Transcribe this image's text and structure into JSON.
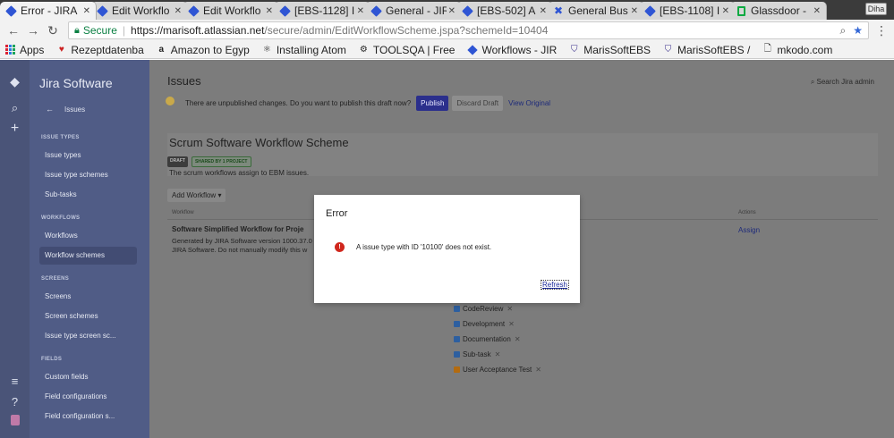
{
  "browser": {
    "tabs": [
      {
        "title": "Error - JIRA",
        "active": true
      },
      {
        "title": "Edit Workflo",
        "active": false
      },
      {
        "title": "Edit Workflo",
        "active": false
      },
      {
        "title": "[EBS-1128] I",
        "active": false
      },
      {
        "title": "General - JIR",
        "active": false
      },
      {
        "title": "[EBS-502] A",
        "active": false
      },
      {
        "title": "General Bus",
        "active": false
      },
      {
        "title": "[EBS-1108] I",
        "active": false
      },
      {
        "title": "Glassdoor - ",
        "active": false
      }
    ],
    "profile_label": "Diha",
    "address": {
      "secure_label": "Secure",
      "host": "https://marisoft.atlassian.net",
      "path": "/secure/admin/EditWorkflowScheme.jspa?schemeId=10404"
    },
    "bookmarks": [
      "Apps",
      "Rezeptdatenba",
      "Amazon to Egyp",
      "Installing Atom",
      "TOOLSQA | Free",
      "Workflows - JIR",
      "MarisSoftEBS",
      "MarisSoftEBS /",
      "mkodo.com"
    ]
  },
  "sidebar": {
    "product": "Jira Software",
    "back_label": "Issues",
    "sections": [
      {
        "title": "ISSUE TYPES",
        "items": [
          "Issue types",
          "Issue type schemes",
          "Sub-tasks"
        ]
      },
      {
        "title": "WORKFLOWS",
        "items": [
          "Workflows",
          "Workflow schemes"
        ]
      },
      {
        "title": "SCREENS",
        "items": [
          "Screens",
          "Screen schemes",
          "Issue type screen sc..."
        ]
      },
      {
        "title": "FIELDS",
        "items": [
          "Custom fields",
          "Field configurations",
          "Field configuration s..."
        ]
      }
    ],
    "selected_item": "Workflow schemes"
  },
  "main": {
    "title": "Issues",
    "search_label": "Search Jira admin",
    "draft_banner": {
      "message": "There are unpublished changes. Do you want to publish this draft now?",
      "publish": "Publish",
      "discard": "Discard Draft",
      "view_original": "View Original"
    },
    "scheme": {
      "title": "Scrum Software Workflow Scheme",
      "lozenge_draft": "DRAFT",
      "lozenge_shared": "SHARED BY 1 PROJECT",
      "description": "The scrum workflows assign to EBM issues."
    },
    "add_workflow": "Add Workflow",
    "table": {
      "col_workflow": "Workflow",
      "col_actions": "Actions",
      "row": {
        "name": "Software Simplified Workflow for Proje",
        "desc_line1": "Generated by JIRA Software version 1000.37.0",
        "desc_line2": "JIRA Software. Do not manually modify this w",
        "action": "Assign"
      }
    },
    "issue_types": [
      "CodeReview",
      "Development",
      "Documentation",
      "Sub-task",
      "User Acceptance Test"
    ]
  },
  "modal": {
    "title": "Error",
    "message": "A issue type with ID '10100' does not exist.",
    "refresh": "Refresh"
  }
}
